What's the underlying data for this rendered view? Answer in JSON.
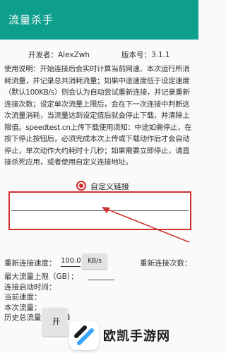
{
  "app": {
    "title": "流量杀手"
  },
  "info": {
    "developer": "开发者：AlexZwh",
    "version": "版本号：3.1.1"
  },
  "description": "使用说明：开始连接后会实时计算当前网速、本次运行所消耗流量，并记录总共消耗流量；如果中途速度低于设定速度（默认100KB/s）则会认为自动尝试重新连接，并记录重新连接次数；设定单次流量上限后，会在下一次连接中判断这次流量消耗，当流量达到设定值后就会停止下载，并清除上限值。speedtest.cn上传下载使用须知：中途如需停止，在按下停止按钮后，必须完成本次上传或下载动作后才会自动停止，单次动作大约耗时十几秒；如果需要立即停止，请直接杀死应用，或者使用自定义连接地址。",
  "custom": {
    "radio_label": "自定义链接",
    "checked": true,
    "input_value": ""
  },
  "settings": {
    "reconnect_speed_label": "重新连接速度：",
    "reconnect_speed_value": "100.0",
    "unit": "KB/s",
    "reconnect_count_label": "重新连接次数：",
    "max_traffic_label": "最大流量上限（GB）：",
    "start_time_label": "连接启动时间：",
    "current_speed_label": "当前速度：",
    "session_traffic_label": "本次流量：",
    "history_total_label": "历史总流量：0.00B"
  },
  "actions": {
    "start_button_partial": "开"
  },
  "watermark": {
    "text": "欧凯手游网"
  },
  "colors": {
    "appbar": "#0e9e8c",
    "accent_red": "#d0302f"
  }
}
